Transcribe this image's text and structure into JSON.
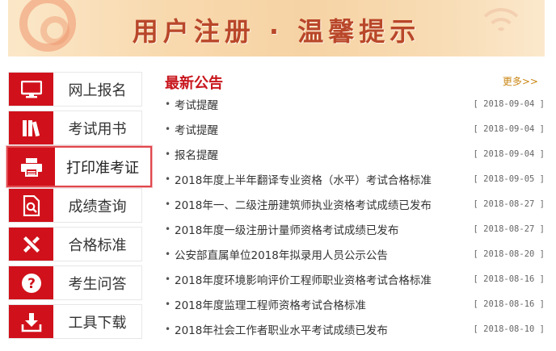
{
  "banner": {
    "title": "用户注册 · 温馨提示"
  },
  "sidebar": {
    "items": [
      {
        "label": "网上报名",
        "icon": "monitor-icon"
      },
      {
        "label": "考试用书",
        "icon": "books-icon"
      },
      {
        "label": "打印准考证",
        "icon": "printer-icon",
        "active": true
      },
      {
        "label": "成绩查询",
        "icon": "search-document-icon"
      },
      {
        "label": "合格标准",
        "icon": "tools-icon"
      },
      {
        "label": "考生问答",
        "icon": "question-icon"
      },
      {
        "label": "工具下载",
        "icon": "download-icon"
      }
    ]
  },
  "notices": {
    "title": "最新公告",
    "more": "更多>>",
    "bullet": "•",
    "items": [
      {
        "text": "考试提醒",
        "date": "[ 2018-09-04 ]"
      },
      {
        "text": "考试提醒",
        "date": "[ 2018-09-04 ]"
      },
      {
        "text": "报名提醒",
        "date": "[ 2018-09-04 ]"
      },
      {
        "text": "2018年度上半年翻译专业资格（水平）考试合格标准",
        "date": "[ 2018-09-05 ]"
      },
      {
        "text": "2018年一、二级注册建筑师执业资格考试成绩已发布",
        "date": "[ 2018-08-27 ]"
      },
      {
        "text": "2018年度一级注册计量师资格考试成绩已发布",
        "date": "[ 2018-08-27 ]"
      },
      {
        "text": "公安部直属单位2018年拟录用人员公示公告",
        "date": "[ 2018-08-20 ]"
      },
      {
        "text": "2018年度环境影响评价工程师职业资格考试合格标准",
        "date": "[ 2018-08-16 ]"
      },
      {
        "text": "2018年度监理工程师资格考试合格标准",
        "date": "[ 2018-08-16 ]"
      },
      {
        "text": "2018年社会工作者职业水平考试成绩已发布",
        "date": "[ 2018-08-10 ]"
      }
    ]
  },
  "colors": {
    "accent": "#d0111b",
    "banner_text": "#b9472a",
    "more": "#c98512"
  }
}
